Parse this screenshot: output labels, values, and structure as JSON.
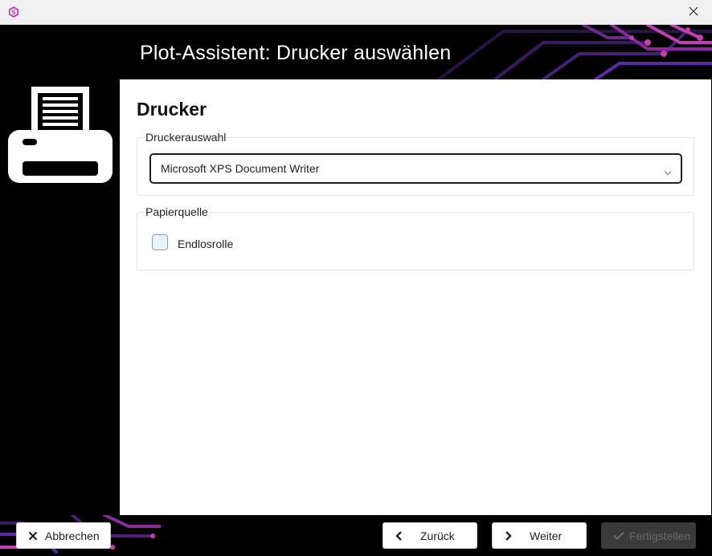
{
  "window": {
    "app_icon": "s-logo-icon",
    "close_icon": "close-icon"
  },
  "header": {
    "title": "Plot-Assistent: Drucker auswählen"
  },
  "side": {
    "icon": "printer-icon"
  },
  "page": {
    "title": "Drucker",
    "printer_group": {
      "legend": "Druckerauswahl",
      "selected_printer": "Microsoft XPS Document Writer"
    },
    "paper_group": {
      "legend": "Papierquelle",
      "checkbox_label": "Endlosrolle",
      "checkbox_checked": false
    }
  },
  "footer": {
    "cancel": "Abbrechen",
    "back": "Zurück",
    "next": "Weiter",
    "finish": "Fertigstellen"
  },
  "colors": {
    "accent_magenta": "#c13fb0",
    "accent_purple": "#5b2aa8",
    "background": "#000000"
  }
}
